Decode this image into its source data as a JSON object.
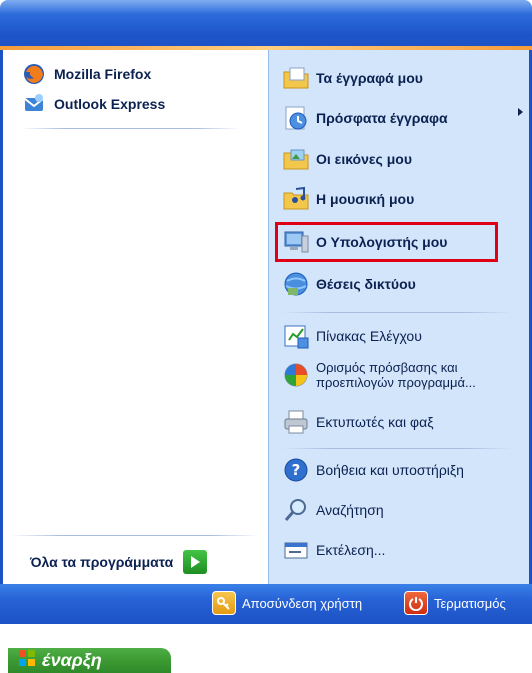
{
  "left_pane": {
    "pinned": [
      {
        "label": "Mozilla Firefox",
        "icon": "firefox-icon"
      },
      {
        "label": "Outlook Express",
        "icon": "outlook-express-icon"
      }
    ],
    "all_programs_label": "Όλα τα προγράμματα"
  },
  "right_pane": {
    "items": [
      {
        "label": "Τα έγγραφά μου",
        "icon": "my-documents-icon"
      },
      {
        "label": "Πρόσφατα έγγραφα",
        "icon": "recent-documents-icon"
      },
      {
        "label": "Οι εικόνες μου",
        "icon": "my-pictures-icon"
      },
      {
        "label": "Η μουσική μου",
        "icon": "my-music-icon"
      },
      {
        "label": "Ο Υπολογιστής μου",
        "icon": "my-computer-icon"
      },
      {
        "label": "Θέσεις δικτύου",
        "icon": "network-places-icon"
      },
      {
        "label": "Πίνακας Ελέγχου",
        "icon": "control-panel-icon"
      },
      {
        "label_line1": "Ορισμός πρόσβασης και",
        "label_line2": "προεπιλογών προγραμμά...",
        "icon": "program-access-icon"
      },
      {
        "label": "Εκτυπωτές και φαξ",
        "icon": "printers-icon"
      },
      {
        "label": "Βοήθεια και υποστήριξη",
        "icon": "help-icon"
      },
      {
        "label": "Αναζήτηση",
        "icon": "search-icon"
      },
      {
        "label": "Εκτέλεση...",
        "icon": "run-icon"
      }
    ]
  },
  "bottom_bar": {
    "logoff_label": "Αποσύνδεση χρήστη",
    "shutdown_label": "Τερματισμός"
  },
  "start_button": {
    "label": "έναρξη"
  },
  "colors": {
    "header_blue": "#1d52c4",
    "right_pane_bg": "#d3e5fa",
    "highlight_red": "#e00016",
    "start_green": "#3c9a33"
  }
}
